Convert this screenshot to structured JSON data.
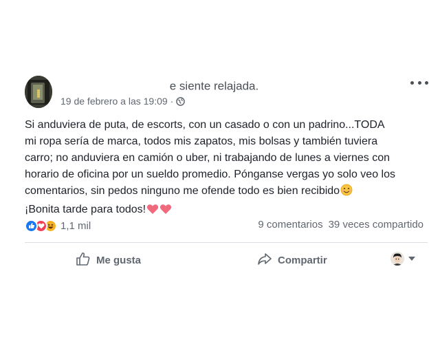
{
  "post": {
    "status": "e siente relajada.",
    "date": "19 de febrero a las 19:09",
    "separator": "·",
    "body_lines": [
      "Si anduviera de puta, de escorts, con un casado o con un padrino...TODA",
      "mi ropa sería de marca, todos mis zapatos, mis bolsas y también tuviera",
      "carro; no anduviera en camión o uber, ni trabajando de lunes a viernes con",
      "horario de oficina por un sueldo promedio. Pónganse vergas yo solo veo los",
      "comentarios, sin pedos ninguno me ofende todo es bien recibido",
      "¡Bonita tarde para todos!"
    ],
    "icons": {
      "audience": "globe-icon",
      "options": "more-options-icon",
      "smile": "smiling-face-emoji",
      "hearts": "heart-emoji"
    }
  },
  "reactions": {
    "count": "1,1 mil",
    "types": [
      "like",
      "love",
      "haha"
    ],
    "colors": {
      "like": "#1877f2",
      "love": "#f33e58",
      "haha": "#f7b125"
    }
  },
  "engagement": {
    "comments": "9 comentarios",
    "shares": "39 veces compartido"
  },
  "actions": {
    "like": "Me gusta",
    "share": "Compartir"
  }
}
